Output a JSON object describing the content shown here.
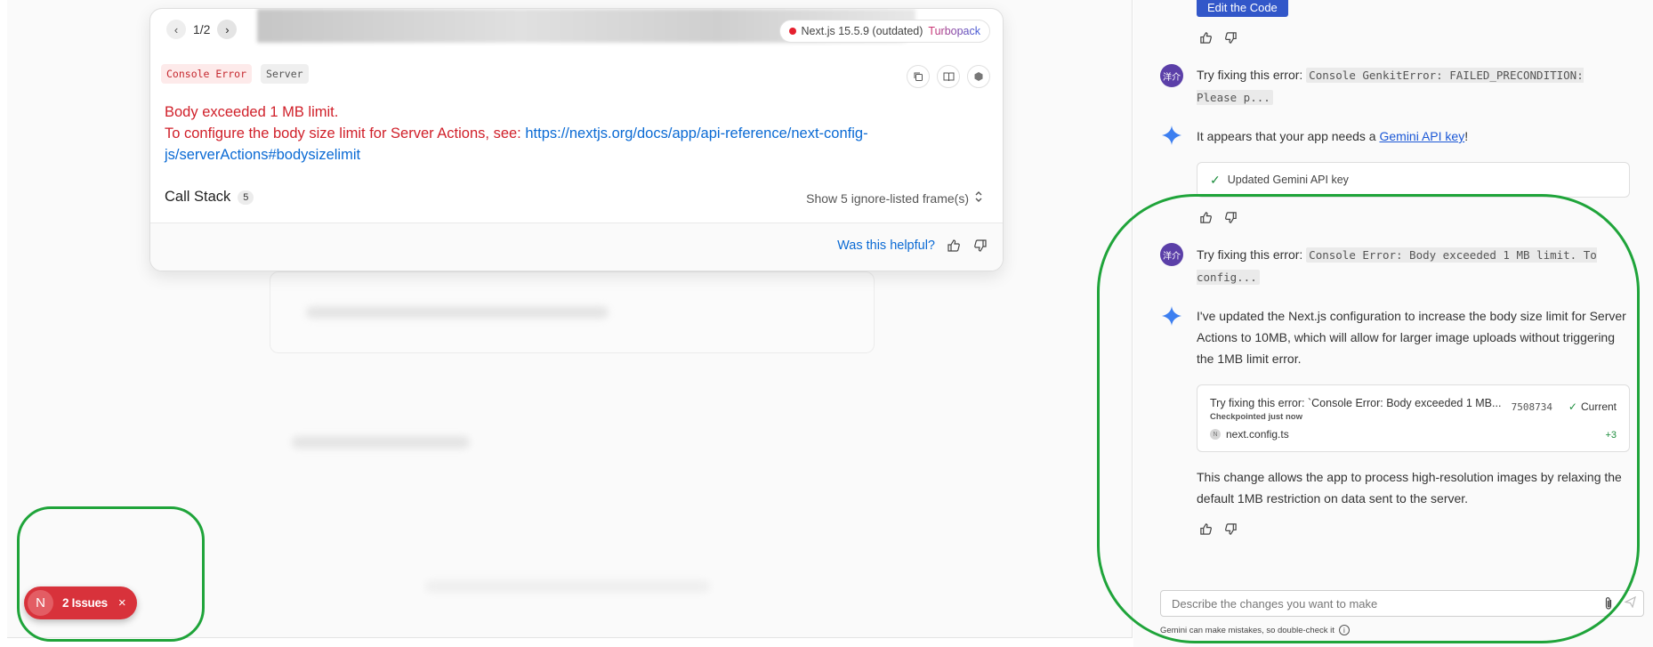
{
  "preview": {
    "pager": {
      "prev": "‹",
      "next": "›",
      "count": "1/2"
    },
    "next_badge": {
      "version": "Next.js 15.5.9 (outdated)",
      "bundler": "Turbopack"
    },
    "labels": [
      "Console Error",
      "Server"
    ],
    "error": {
      "line1": "Body exceeded 1 MB limit.",
      "line2_prefix": "To configure the body size limit for Server Actions, see: ",
      "link": "https://nextjs.org/docs/app/api-reference/next-config-js/serverActions#bodysizelimit"
    },
    "call_stack": {
      "label": "Call Stack",
      "count": "5"
    },
    "ignore_listed": "Show 5 ignore-listed frame(s)",
    "helpful": "Was this helpful?",
    "issues_pill": {
      "logo": "N",
      "text": "2 Issues",
      "close": "×"
    }
  },
  "chat": {
    "edit_button": "Edit the Code",
    "user_avatar": "洋介",
    "msg1": {
      "prefix": "Try fixing this error: ",
      "code": "Console GenkitError: FAILED_PRECONDITION: Please p..."
    },
    "ai1": {
      "prefix": "It appears that your app needs a ",
      "link": "Gemini API key",
      "suffix": "!"
    },
    "card1": "Updated Gemini API key",
    "msg2": {
      "prefix": "Try fixing this error: ",
      "code": "Console Error: Body exceeded 1 MB limit. To config..."
    },
    "ai2": "I've updated the Next.js configuration to increase the body size limit for Server Actions to 10MB, which will allow for larger image uploads without triggering the 1MB limit error.",
    "checkpoint": {
      "title": "Try fixing this error: `Console Error: Body exceeded 1 MB...",
      "sub": "Checkpointed just now",
      "hash": "7508734",
      "status": "Current",
      "file": "next.config.ts",
      "plus": "+3"
    },
    "ai3": "This change allows the app to process high-resolution images by relaxing the default 1MB restriction on data sent to the server.",
    "input_placeholder": "Describe the changes you want to make",
    "disclaimer": "Gemini can make mistakes, so double-check it"
  },
  "colors": {
    "annotation": "#1fa43a",
    "error": "#d0202a",
    "issues_pill": "#d8323b",
    "edit_button": "#3257c9"
  }
}
